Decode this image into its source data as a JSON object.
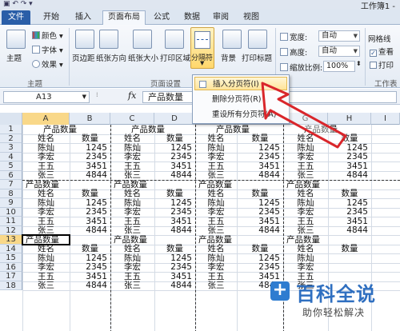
{
  "window": {
    "title": "工作簿1 -",
    "qat": "▣ ↶ ↷ ▾"
  },
  "tabs": [
    "文件",
    "开始",
    "插入",
    "页面布局",
    "公式",
    "数据",
    "审阅",
    "视图"
  ],
  "ribbon": {
    "theme_group": {
      "theme_label": "主题",
      "colors": "颜色",
      "fonts": "字体",
      "effects": "效果",
      "group_label": "主题"
    },
    "page_setup": {
      "margins": "页边距",
      "orientation": "纸张方向",
      "size": "纸张大小",
      "print_area": "打印区域",
      "breaks": "分隔符",
      "background": "背景",
      "print_titles": "打印标题",
      "group_label": "页面设置"
    },
    "scale": {
      "width_label": "宽度:",
      "width_value": "自动",
      "height_label": "高度:",
      "height_value": "自动",
      "scale_label": "缩放比例:",
      "scale_value": "100%",
      "group_label": "调整为合适大小"
    },
    "sheet_options": {
      "gridlines_label": "网格线",
      "view_label": "查看",
      "view_checked": true,
      "print_label": "打印",
      "group_label": "工作表"
    }
  },
  "menu": {
    "items": [
      "插入分页符(I)",
      "删除分页符(R)",
      "重设所有分页符(A)"
    ],
    "hover_index": 0
  },
  "formula_bar": {
    "name_box": "A13",
    "fx": "fx",
    "content": "产品数量"
  },
  "grid": {
    "columns": [
      "A",
      "B",
      "C",
      "D",
      "E",
      "F",
      "G",
      "H",
      "I"
    ],
    "selected_column": "A",
    "selected_row": 13,
    "rows": [
      {
        "n": 1,
        "cells": [
          "产品数量",
          "",
          "产品数量",
          "",
          "产品数量",
          "",
          "产品数量",
          "",
          ""
        ]
      },
      {
        "n": 2,
        "cells": [
          "姓名",
          "数量",
          "姓名",
          "数量",
          "姓名",
          "数量",
          "姓名",
          "数量",
          ""
        ]
      },
      {
        "n": 3,
        "cells": [
          "陈灿",
          "1245",
          "陈灿",
          "1245",
          "陈灿",
          "1245",
          "陈灿",
          "1245",
          ""
        ]
      },
      {
        "n": 4,
        "cells": [
          "李宏",
          "2345",
          "李宏",
          "2345",
          "李宏",
          "2345",
          "李宏",
          "2345",
          ""
        ]
      },
      {
        "n": 5,
        "cells": [
          "王五",
          "3451",
          "王五",
          "3451",
          "王五",
          "3451",
          "王五",
          "3451",
          ""
        ]
      },
      {
        "n": 6,
        "cells": [
          "张三",
          "4844",
          "张三",
          "4844",
          "张三",
          "4844",
          "张三",
          "4844",
          ""
        ]
      },
      {
        "n": 7,
        "cells": [
          "产品数量",
          "",
          "产品数量",
          "",
          "产品数量",
          "",
          "产品数量",
          "",
          ""
        ]
      },
      {
        "n": 8,
        "cells": [
          "姓名",
          "数量",
          "姓名",
          "数量",
          "姓名",
          "数量",
          "姓名",
          "数量",
          ""
        ]
      },
      {
        "n": 9,
        "cells": [
          "陈灿",
          "1245",
          "陈灿",
          "1245",
          "陈灿",
          "1245",
          "陈灿",
          "1245",
          ""
        ]
      },
      {
        "n": 10,
        "cells": [
          "李宏",
          "2345",
          "李宏",
          "2345",
          "李宏",
          "2345",
          "李宏",
          "2345",
          ""
        ]
      },
      {
        "n": 11,
        "cells": [
          "王五",
          "3451",
          "王五",
          "3451",
          "王五",
          "3451",
          "王五",
          "3451",
          ""
        ]
      },
      {
        "n": 12,
        "cells": [
          "张三",
          "4844",
          "张三",
          "4844",
          "张三",
          "4844",
          "张三",
          "4844",
          ""
        ]
      },
      {
        "n": 13,
        "cells": [
          "产品数量",
          "",
          "产品数量",
          "",
          "产品数量",
          "",
          "产品数量",
          "",
          ""
        ]
      },
      {
        "n": 14,
        "cells": [
          "姓名",
          "数量",
          "姓名",
          "数量",
          "姓名",
          "数量",
          "姓名",
          "数量",
          ""
        ]
      },
      {
        "n": 15,
        "cells": [
          "陈灿",
          "1245",
          "陈灿",
          "1245",
          "陈灿",
          "1245",
          "陈灿",
          "",
          ""
        ]
      },
      {
        "n": 16,
        "cells": [
          "李宏",
          "2345",
          "李宏",
          "2345",
          "李宏",
          "2345",
          "李宏",
          "",
          ""
        ]
      },
      {
        "n": 17,
        "cells": [
          "王五",
          "3451",
          "王五",
          "3451",
          "王五",
          "3451",
          "王五",
          "",
          ""
        ]
      },
      {
        "n": 18,
        "cells": [
          "张三",
          "4844",
          "张三",
          "4844",
          "张三",
          "4844",
          "张三",
          "",
          ""
        ]
      }
    ]
  },
  "watermark": {
    "logo": "+",
    "brand": "百科全说",
    "slogan": "助你轻松解决"
  },
  "colors": {
    "accent": "#2a5ea8",
    "highlight": "#ffd76b",
    "arrow": "#d9262b"
  }
}
